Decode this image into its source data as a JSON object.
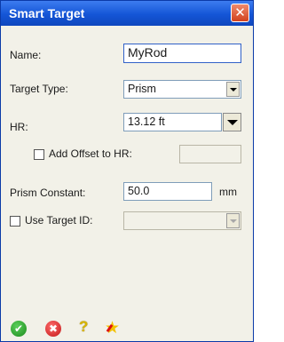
{
  "window": {
    "title": "Smart Target",
    "close_glyph": "✕"
  },
  "form": {
    "name_label": "Name:",
    "name_value": "MyRod",
    "target_type_label": "Target Type:",
    "target_type_value": "Prism",
    "hr_label": "HR:",
    "hr_value": "13.12 ft",
    "add_offset_label": "Add Offset to HR:",
    "add_offset_checked": false,
    "add_offset_value": "",
    "prism_constant_label": "Prism Constant:",
    "prism_constant_value": "50.0",
    "prism_constant_unit": "mm",
    "use_target_id_label": "Use Target ID:",
    "use_target_id_checked": false,
    "target_id_value": ""
  },
  "toolbar": {
    "icons": [
      "ok-icon",
      "cancel-icon",
      "help-icon",
      "pin-star-icon"
    ],
    "help_glyph": "?",
    "ok_glyph": "✔",
    "cancel_glyph": "✖",
    "star_glyph": "★"
  }
}
